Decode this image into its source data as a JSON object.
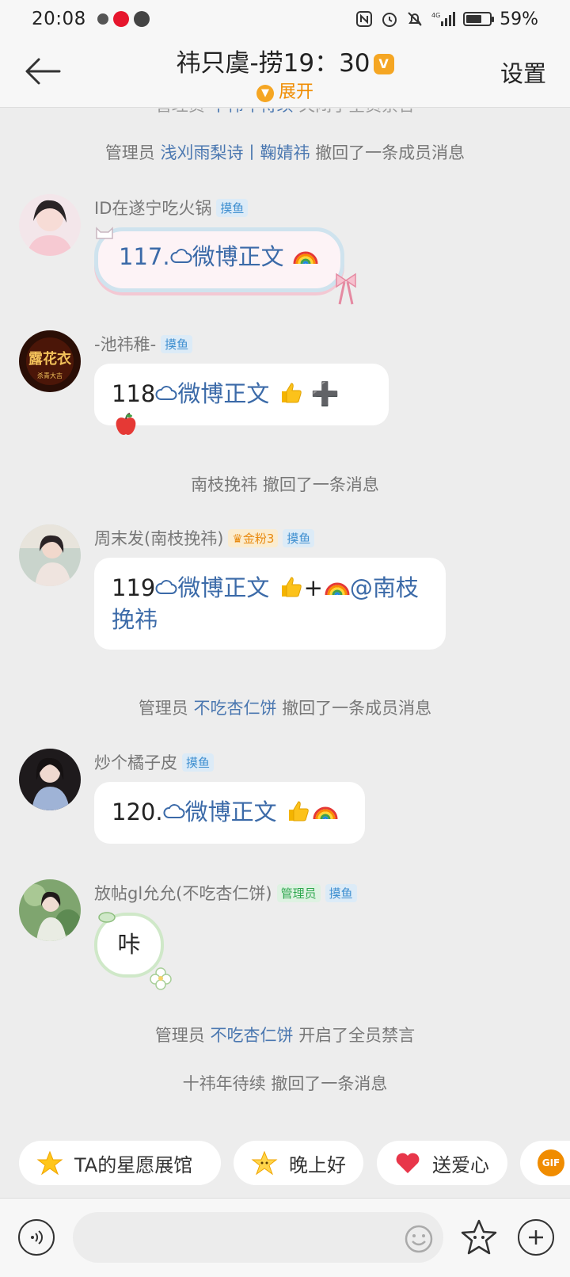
{
  "status_bar": {
    "time": "20:08",
    "battery": "59%",
    "battery_level": 0.59
  },
  "header": {
    "title": "祎只虞-捞19：30",
    "expand_label": "展开",
    "settings_label": "设置"
  },
  "messages": {
    "cut_system": {
      "prefix": "管理员",
      "name": "十祎年待续",
      "suffix": "关闭了全员禁言"
    },
    "system_1": {
      "prefix": "管理员",
      "name": "浅刈雨梨诗丨鞠婧祎",
      "suffix": "撤回了一条成员消息"
    },
    "m117": {
      "username": "ID在遂宁吃火锅",
      "tag": "摸鱼",
      "num": "117.",
      "text": "微博正文"
    },
    "m118": {
      "username": "-池祎稚-",
      "tag": "摸鱼",
      "num": "118",
      "text": "微博正文",
      "plus": "➕"
    },
    "system_2": {
      "name": "南枝挽祎",
      "suffix": "撤回了一条消息"
    },
    "m119": {
      "username": "周末发(南枝挽祎)",
      "fan_badge": "金粉3",
      "tag": "摸鱼",
      "num": "119",
      "text": "微博正文",
      "plus": "+",
      "mention_1": "@南枝",
      "mention_2": "挽祎"
    },
    "system_3": {
      "prefix": "管理员",
      "name": "不吃杏仁饼",
      "suffix": "撤回了一条成员消息"
    },
    "m120": {
      "username": "炒个橘子皮",
      "tag": "摸鱼",
      "num": "120.",
      "text": "微博正文"
    },
    "m121": {
      "username": "放帖gl允允(不吃杏仁饼)",
      "admin_tag": "管理员",
      "tag": "摸鱼",
      "text": "咔"
    },
    "system_4": {
      "prefix": "管理员",
      "name": "不吃杏仁饼",
      "suffix": "开启了全员禁言"
    },
    "system_5": {
      "name": "十祎年待续",
      "suffix": "撤回了一条消息"
    }
  },
  "quick_actions": {
    "star": "TA的星愿展馆",
    "evening": "晚上好",
    "heart": "送爱心",
    "gif": "GIF"
  },
  "input": {
    "placeholder": ""
  },
  "colors": {
    "accent": "#f5a623",
    "link": "#4a77b0",
    "background": "#ededed"
  }
}
